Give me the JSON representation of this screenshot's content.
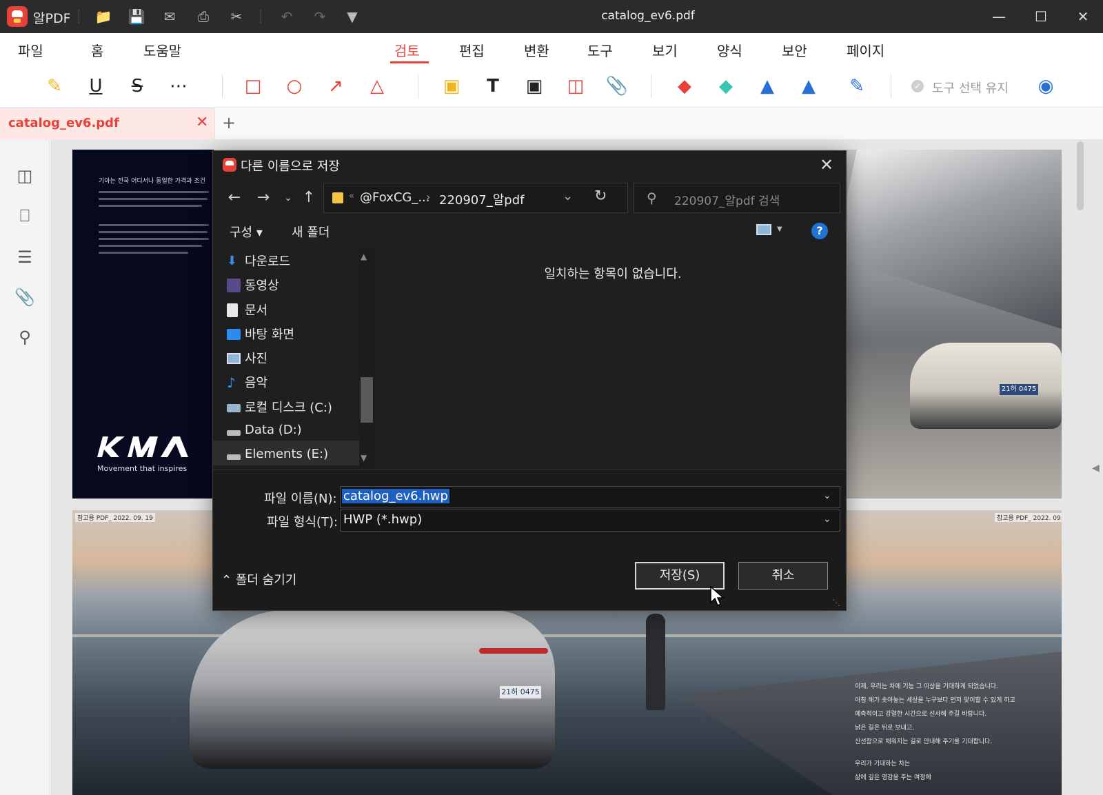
{
  "app": {
    "name": "알PDF",
    "window_title": "catalog_ev6.pdf"
  },
  "quick_access": [
    {
      "name": "open-folder-icon"
    },
    {
      "name": "save-icon"
    },
    {
      "name": "mail-icon"
    },
    {
      "name": "print-icon"
    },
    {
      "name": "scissors-icon"
    },
    {
      "name": "undo-icon"
    },
    {
      "name": "redo-icon"
    },
    {
      "name": "customize-dropdown-icon"
    }
  ],
  "menu": {
    "items": [
      "파일",
      "홈",
      "도움말",
      "검토",
      "편집",
      "변환",
      "도구",
      "보기",
      "양식",
      "보안",
      "페이지"
    ],
    "active": "검토"
  },
  "toolbar": {
    "tools": [
      "highlight-icon",
      "underline-icon",
      "strikethrough-icon",
      "more-markup-icon",
      "rectangle-icon",
      "ellipse-icon",
      "arrow-icon",
      "shape-dropdown-icon",
      "sticky-note-icon",
      "text-icon",
      "text-box-icon",
      "callout-icon",
      "attach-icon",
      "eraser-red-icon",
      "eraser-teal-icon",
      "stamp-icon",
      "stamp-dropdown-icon",
      "signature-icon"
    ],
    "keep_tool_label": "도구 선택 유지",
    "preview_icon": "eye-icon"
  },
  "tabs": {
    "document_tab": "catalog_ev6.pdf",
    "add_tab": "+"
  },
  "side_panel": {
    "icons": [
      "thumbnail-icon",
      "bookmark-icon",
      "comment-icon",
      "attachment-icon",
      "search-icon"
    ]
  },
  "document": {
    "page1": {
      "brand_tagline": "Movement that inspires",
      "intro_heading": "기아는 전국 어디서나 동일한 가격과 조건",
      "plate": "21허 0475"
    },
    "page2": {
      "stamp": "참고용 PDF_ 2022. 09. 19",
      "plate": "21허 0475",
      "body_lines": [
        "이제, 우리는 차에 기능 그 이상을 기대하게 되었습니다.",
        "아침 해가 솟아놓는 세상을 누구보다 먼저 맞이할 수 있게 하고",
        "예측적이고 강렬한 시간으로 선사해 주길 바랍니다.",
        "낡은 길은 뒤로 보내고,",
        "신선함으로 채워지는 길로 안내해 주기를 기대합니다.",
        "우리가 기대하는 차는",
        "삶에 깊은 영감을 주는 여정에"
      ]
    }
  },
  "dialog": {
    "title": "다른 이름으로 저장",
    "address": {
      "segment1": "@FoxCG_...",
      "segment2": "220907_알pdf"
    },
    "search_placeholder": "220907_알pdf 검색",
    "commands": {
      "organize": "구성 ▾",
      "new_folder": "새 폴더"
    },
    "help": "?",
    "nav_items": [
      {
        "label": "다운로드",
        "icon": "download-icon",
        "color": "#3b8ee8"
      },
      {
        "label": "동영상",
        "icon": "video-icon",
        "color": "#7b5fb0"
      },
      {
        "label": "문서",
        "icon": "document-icon",
        "color": "#e8e8e8"
      },
      {
        "label": "바탕 화면",
        "icon": "desktop-icon",
        "color": "#2a8cf0"
      },
      {
        "label": "사진",
        "icon": "pictures-icon",
        "color": "#8fb5d9"
      },
      {
        "label": "음악",
        "icon": "music-icon",
        "color": "#3b8ee8"
      },
      {
        "label": "로컬 디스크 (C:)",
        "icon": "local-disk-icon",
        "color": "#9bb3c8"
      },
      {
        "label": "Data (D:)",
        "icon": "drive-icon",
        "color": "#bbbbbb"
      },
      {
        "label": "Elements (E:)",
        "icon": "drive-icon",
        "color": "#bbbbbb"
      }
    ],
    "empty_message": "일치하는 항목이 없습니다.",
    "file_name_label": "파일 이름(N):",
    "file_name_value": "catalog_ev6.hwp",
    "file_type_label": "파일 형식(T):",
    "file_type_value": "HWP (*.hwp)",
    "hide_folders": "폴더 숨기기",
    "save_button": "저장(S)",
    "cancel_button": "취소"
  }
}
